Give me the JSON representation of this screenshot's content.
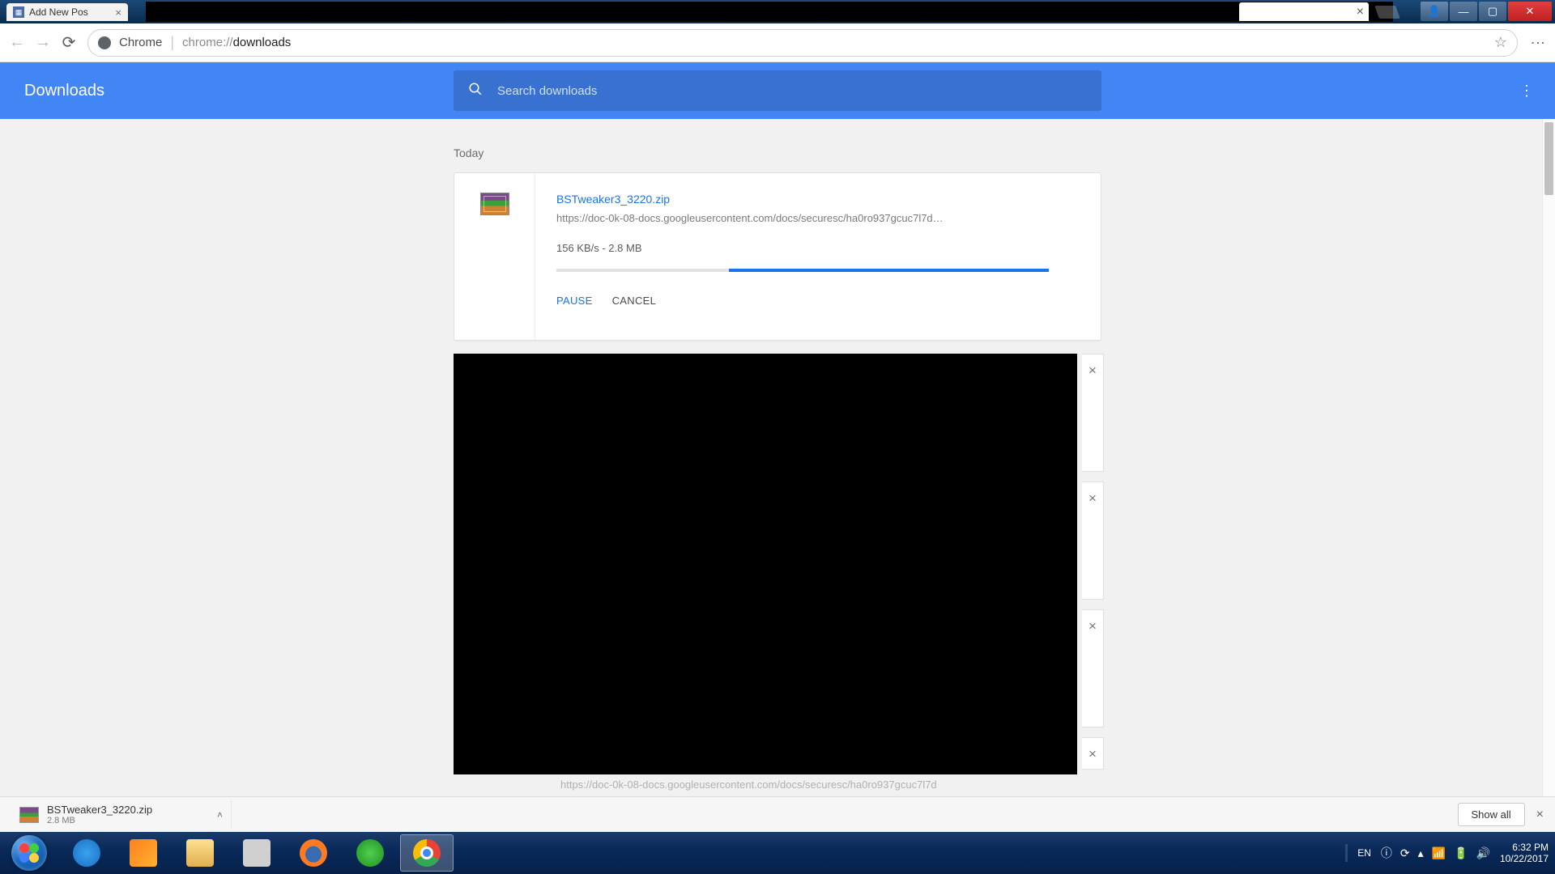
{
  "window": {
    "tab_label": "Add New Pos"
  },
  "addressbar": {
    "scheme_label": "Chrome",
    "url_prefix": "chrome://",
    "url_path": "downloads"
  },
  "header": {
    "title": "Downloads",
    "search_placeholder": "Search downloads"
  },
  "list": {
    "section": "Today",
    "items": [
      {
        "filename": "BSTweaker3_3220.zip",
        "url": "https://doc-0k-08-docs.googleusercontent.com/docs/securesc/ha0ro937gcuc7l7d…",
        "status": "156 KB/s - 2.8 MB",
        "progress_pct": 65,
        "action_pause": "PAUSE",
        "action_cancel": "CANCEL"
      }
    ],
    "trailing_url": "https://doc-0k-08-docs.googleusercontent.com/docs/securesc/ha0ro937gcuc7l7d"
  },
  "shelf": {
    "item_name": "BSTweaker3_3220.zip",
    "item_size": "2.8 MB",
    "show_all": "Show all"
  },
  "tray": {
    "lang": "EN",
    "time": "6:32 PM",
    "date": "10/22/2017"
  }
}
